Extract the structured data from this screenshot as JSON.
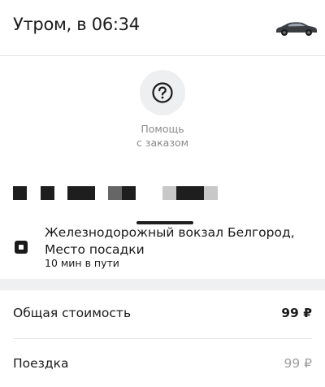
{
  "header": {
    "title": "Утром, в 06:34",
    "car_icon": "car-icon"
  },
  "help": {
    "icon": "question-circle-icon",
    "label_line1": "Помощь",
    "label_line2": "с заказом"
  },
  "route": {
    "icon": "stop-square-icon",
    "address": "Железнодорожный вокзал Белгород, Место посадки",
    "eta": "10 мин в пути"
  },
  "pricing": {
    "total_label": "Общая стоимость",
    "total_value": "99 ₽",
    "ride_label": "Поездка",
    "ride_value": "99 ₽"
  },
  "colors": {
    "background": "#ffffff",
    "text": "#1a1a1a",
    "muted": "#8a8a8a",
    "band": "#eef0f2"
  }
}
